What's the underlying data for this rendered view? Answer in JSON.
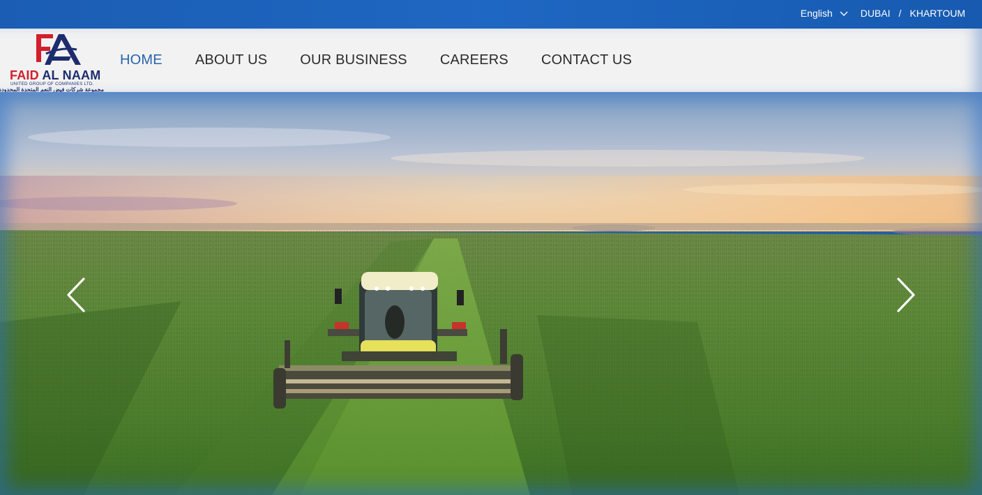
{
  "topbar": {
    "language": "English",
    "cities": [
      "DUBAI",
      "KHARTOUM"
    ],
    "separator": "/"
  },
  "logo": {
    "mark": "FA",
    "name_part1": "FAID",
    "name_part2": "AL NAAM",
    "subtitle": "UNITED GROUP OF COMPANIES LTD.",
    "arabic": "مجموعة شركات فيض النعم المتحدة المحدودة"
  },
  "nav": {
    "items": [
      {
        "label": "HOME",
        "active": true
      },
      {
        "label": "ABOUT US",
        "active": false
      },
      {
        "label": "OUR BUSINESS",
        "active": false
      },
      {
        "label": "CAREERS",
        "active": false
      },
      {
        "label": "CONTACT US",
        "active": false
      }
    ]
  },
  "hero": {
    "prev_icon": "chevron-left-icon",
    "next_icon": "chevron-right-icon"
  },
  "colors": {
    "brand_blue": "#1d2c6e",
    "brand_red": "#d21f2b",
    "topbar_blue": "#1e63bd",
    "nav_active": "#2a63ad"
  }
}
